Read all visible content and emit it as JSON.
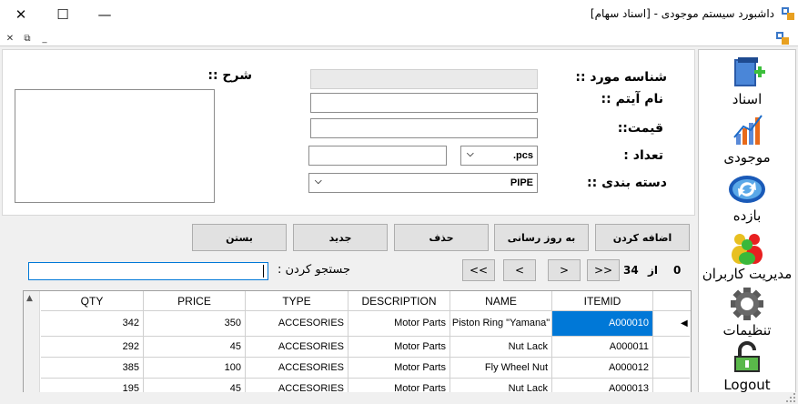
{
  "window": {
    "title": "داشبورد سیستم موجودی - [اسناد سهام]",
    "minimize_glyph": "—",
    "maximize_glyph": "☐",
    "close_glyph": "✕"
  },
  "mdi": {
    "close_glyph": "✕",
    "restore_glyph": "⧉",
    "minimize_glyph": "_"
  },
  "sidebar": {
    "items": [
      {
        "label": "اسناد",
        "icon": "documents-icon"
      },
      {
        "label": "موجودی",
        "icon": "chart-icon"
      },
      {
        "label": "بازده",
        "icon": "refresh-icon"
      },
      {
        "label": "مدیریت کاربران",
        "icon": "users-icon"
      },
      {
        "label": "تنظیمات",
        "icon": "gear-icon"
      },
      {
        "label": "Logout",
        "icon": "logout-lock-icon"
      }
    ]
  },
  "form": {
    "item_id_label": "شناسه مورد ::",
    "item_name_label": "نام آیتم ::",
    "price_label": "قیمت::",
    "count_label": "تعداد :",
    "category_label": "دسته بندی ::",
    "description_label": "شرح ::",
    "unit_value": ".pcs",
    "category_value": "PIPE",
    "combo_arrow": "⌵"
  },
  "buttons": {
    "add": "اضافه کردن",
    "update": "به روز رسانی",
    "delete": "حذف",
    "new": "جدید",
    "close": "بستن"
  },
  "pager": {
    "current": "0",
    "of_label": "از",
    "total": "34",
    "first": "<<",
    "prev": "<",
    "next": ">",
    "last": ">>"
  },
  "search": {
    "label": "جستجو کردن :",
    "value": ""
  },
  "grid": {
    "columns": [
      "ITEMID",
      "NAME",
      "DESCRIPTION",
      "TYPE",
      "PRICE",
      "QTY"
    ],
    "rows": [
      [
        "A000010",
        "Piston Ring \"Yamana\"",
        "Motor Parts",
        "ACCESORIES",
        "350",
        "342"
      ],
      [
        "A000011",
        "Nut Lack",
        "Motor Parts",
        "ACCESORIES",
        "45",
        "292"
      ],
      [
        "A000012",
        "Fly Wheel Nut",
        "Motor Parts",
        "ACCESORIES",
        "100",
        "385"
      ],
      [
        "A000013",
        "Nut Lack",
        "Motor Parts",
        "ACCESORIES",
        "45",
        "195"
      ]
    ],
    "current_row_marker": "◀",
    "scroll_up_glyph": "▲"
  },
  "colors": {
    "selection": "#0078d7",
    "button_face": "#e1e1e1"
  }
}
